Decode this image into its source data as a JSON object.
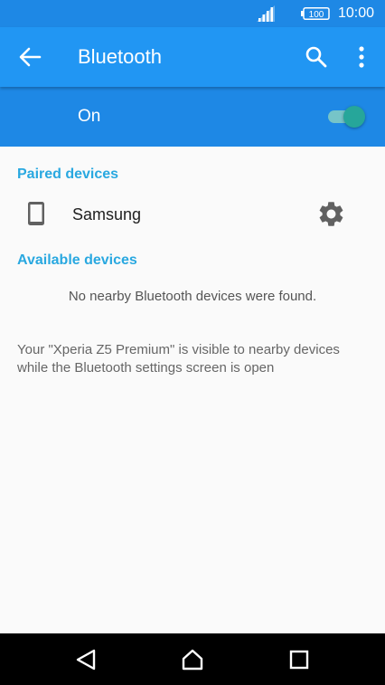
{
  "status_bar": {
    "battery_level": "100",
    "time": "10:00",
    "background": "#1e88e5"
  },
  "app_bar": {
    "title": "Bluetooth",
    "icons": [
      "back-arrow-icon",
      "search-icon",
      "more-vert-icon"
    ],
    "background": "#2196f3"
  },
  "master_switch": {
    "label": "On",
    "checked": true,
    "accent": "#26a69a"
  },
  "paired_section": {
    "header": "Paired devices",
    "devices": [
      {
        "name": "Samsung",
        "icon": "smartphone-icon",
        "action_icon": "gear-icon"
      }
    ]
  },
  "available_section": {
    "header": "Available devices",
    "empty_message": "No nearby Bluetooth devices were found."
  },
  "visibility_note": "Your \"Xperia Z5 Premium\" is visible to nearby devices while the Bluetooth settings screen is open",
  "nav_bar": {
    "icons": [
      "nav-back-icon",
      "nav-home-icon",
      "nav-recents-icon"
    ]
  },
  "colors": {
    "accent_header": "#29a8e0",
    "toggle_thumb": "#26a69a"
  }
}
